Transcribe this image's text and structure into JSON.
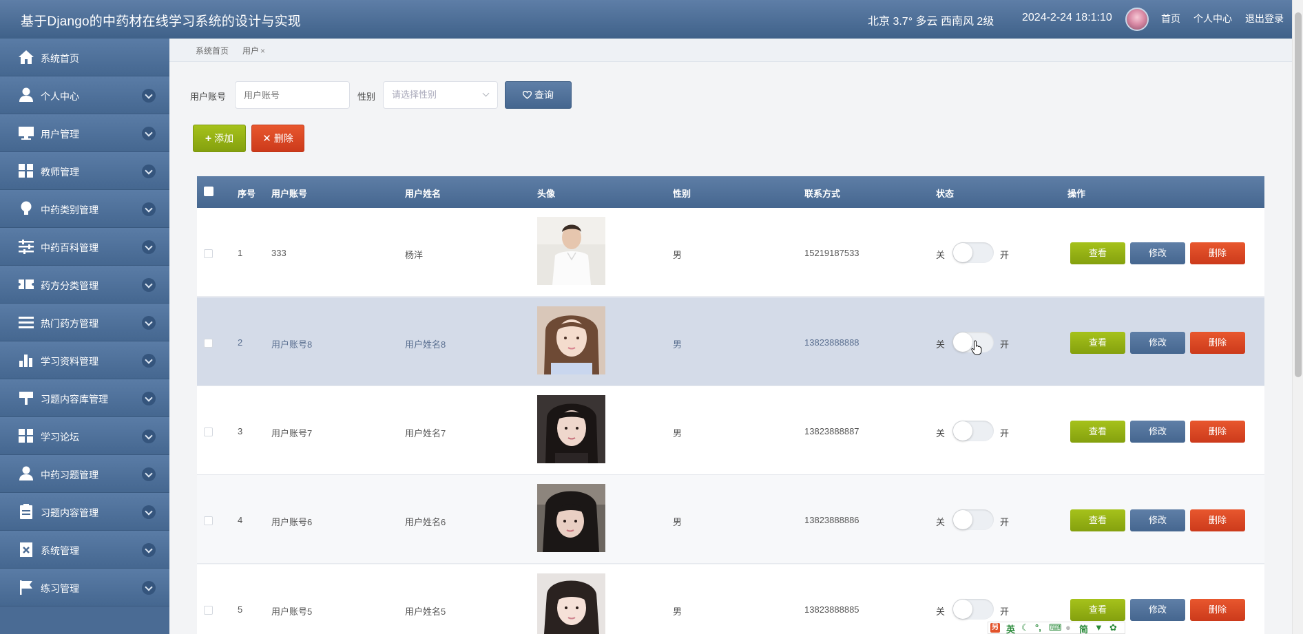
{
  "header": {
    "title": "基于Django的中药材在线学习系统的设计与实现",
    "weather": "北京  3.7°  多云  西南风  2级",
    "datetime": "2024-2-24 18:1:10",
    "links": [
      "首页",
      "个人中心",
      "退出登录"
    ]
  },
  "sidebar": {
    "items": [
      {
        "label": "系统首页",
        "icon": "home-icon"
      },
      {
        "label": "个人中心",
        "icon": "user-icon"
      },
      {
        "label": "用户管理",
        "icon": "monitor-icon"
      },
      {
        "label": "教师管理",
        "icon": "grid-icon"
      },
      {
        "label": "中药类别管理",
        "icon": "bulb-icon"
      },
      {
        "label": "中药百科管理",
        "icon": "sliders-icon"
      },
      {
        "label": "药方分类管理",
        "icon": "ticket-icon"
      },
      {
        "label": "热门药方管理",
        "icon": "list-icon"
      },
      {
        "label": "学习资料管理",
        "icon": "bar-chart-icon"
      },
      {
        "label": "习题内容库管理",
        "icon": "signpost-icon"
      },
      {
        "label": "学习论坛",
        "icon": "grid-icon"
      },
      {
        "label": "中药习题管理",
        "icon": "user-card-icon"
      },
      {
        "label": "习题内容管理",
        "icon": "clipboard-icon"
      },
      {
        "label": "系统管理",
        "icon": "doc-x-icon"
      },
      {
        "label": "练习管理",
        "icon": "flag-icon"
      }
    ]
  },
  "breadcrumb": {
    "home": "系统首页",
    "current": "用户",
    "close": "×"
  },
  "filters": {
    "account_label": "用户账号",
    "account_placeholder": "用户账号",
    "gender_label": "性别",
    "gender_placeholder": "请选择性别",
    "query_button": "查询"
  },
  "toolbar": {
    "add_button": "添加",
    "delete_button": "删除"
  },
  "table": {
    "columns": [
      "序号",
      "用户账号",
      "用户姓名",
      "头像",
      "性别",
      "联系方式",
      "状态",
      "操作"
    ],
    "rows": [
      {
        "index": "1",
        "account": "333",
        "name": "杨洋",
        "gender": "男",
        "phone": "15219187533",
        "status_on": false
      },
      {
        "index": "2",
        "account": "用户账号8",
        "name": "用户姓名8",
        "gender": "男",
        "phone": "13823888888",
        "status_on": false
      },
      {
        "index": "3",
        "account": "用户账号7",
        "name": "用户姓名7",
        "gender": "男",
        "phone": "13823888887",
        "status_on": false
      },
      {
        "index": "4",
        "account": "用户账号6",
        "name": "用户姓名6",
        "gender": "男",
        "phone": "13823888886",
        "status_on": false
      },
      {
        "index": "5",
        "account": "用户账号5",
        "name": "用户姓名5",
        "gender": "男",
        "phone": "13823888885",
        "status_on": false
      }
    ],
    "switch_off_label": "关",
    "switch_on_label": "开",
    "actions": {
      "view": "查看",
      "edit": "修改",
      "delete": "删除"
    }
  },
  "ime": {
    "lang": "英",
    "mode": "简"
  },
  "colors": {
    "header": "#4a6b94",
    "accent_green": "#95b013",
    "accent_red": "#db4623",
    "accent_blue": "#4f7099"
  }
}
